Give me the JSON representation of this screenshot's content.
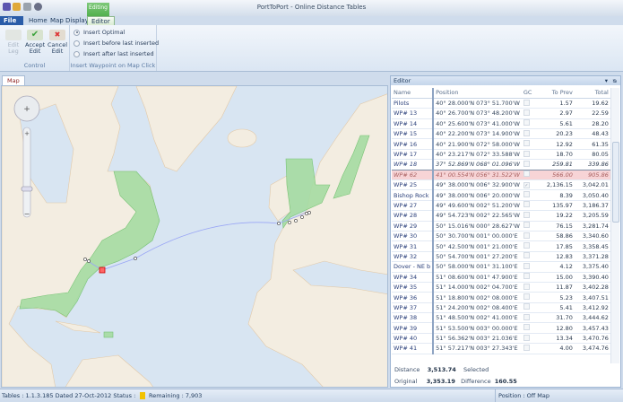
{
  "window": {
    "title": "PortToPort - Online Distance Tables",
    "context_tab": "Editing"
  },
  "menu_tabs": [
    "File",
    "Home",
    "Map Display",
    "Editor"
  ],
  "ribbon": {
    "control": {
      "label": "Control",
      "buttons": [
        "Edit Leg",
        "Accept Edit",
        "Cancel Edit"
      ]
    },
    "insert": {
      "label": "Insert Waypoint on Map Click",
      "options": [
        "Insert Optimal",
        "Insert before last inserted",
        "Insert after last inserted"
      ],
      "selected": 0
    }
  },
  "map": {
    "tab": "Map",
    "colors": {
      "water": "#d8e5f2",
      "land": "#f3ede1",
      "highlight": "#a6dca2",
      "route": "#9aa6f5"
    }
  },
  "editor": {
    "title": "Editor",
    "columns": [
      "Name",
      "Position",
      "GC",
      "To Prev",
      "Total"
    ],
    "rows": [
      {
        "name": "Pilots",
        "pos": "40° 28.000'N 073° 51.700'W",
        "gc": false,
        "prev": "1.57",
        "total": "19.62"
      },
      {
        "name": "WP# 13",
        "pos": "40° 26.700'N 073° 48.200'W",
        "gc": false,
        "prev": "2.97",
        "total": "22.59"
      },
      {
        "name": "WP# 14",
        "pos": "40° 25.600'N 073° 41.000'W",
        "gc": false,
        "prev": "5.61",
        "total": "28.20"
      },
      {
        "name": "WP# 15",
        "pos": "40° 22.200'N 073° 14.900'W",
        "gc": false,
        "prev": "20.23",
        "total": "48.43"
      },
      {
        "name": "WP# 16",
        "pos": "40° 21.900'N 072° 58.000'W",
        "gc": false,
        "prev": "12.92",
        "total": "61.35"
      },
      {
        "name": "WP# 17",
        "pos": "40° 23.217'N 072° 33.588'W",
        "gc": false,
        "prev": "18.70",
        "total": "80.05"
      },
      {
        "name": "WP# 18",
        "pos": "37° 52.869'N 068° 01.096'W",
        "gc": false,
        "prev": "259.81",
        "total": "339.86",
        "state": "sel"
      },
      {
        "name": "WP# 62",
        "pos": "41° 00.554'N 056° 31.522'W",
        "gc": false,
        "prev": "566.00",
        "total": "905.86",
        "state": "pink"
      },
      {
        "name": "WP# 25",
        "pos": "49° 38.000'N 006° 32.900'W",
        "gc": true,
        "prev": "2,136.15",
        "total": "3,042.01"
      },
      {
        "name": "Bishop Rock",
        "pos": "49° 38.000'N 006° 20.000'W",
        "gc": false,
        "prev": "8.39",
        "total": "3,050.40"
      },
      {
        "name": "WP# 27",
        "pos": "49° 49.600'N 002° 51.200'W",
        "gc": false,
        "prev": "135.97",
        "total": "3,186.37"
      },
      {
        "name": "WP# 28",
        "pos": "49° 54.723'N 002° 22.565'W",
        "gc": false,
        "prev": "19.22",
        "total": "3,205.59"
      },
      {
        "name": "WP# 29",
        "pos": "50° 15.016'N 000° 28.627'W",
        "gc": false,
        "prev": "76.15",
        "total": "3,281.74"
      },
      {
        "name": "WP# 30",
        "pos": "50° 30.700'N 001° 00.000'E",
        "gc": false,
        "prev": "58.86",
        "total": "3,340.60"
      },
      {
        "name": "WP# 31",
        "pos": "50° 42.500'N 001° 21.000'E",
        "gc": false,
        "prev": "17.85",
        "total": "3,358.45"
      },
      {
        "name": "WP# 32",
        "pos": "50° 54.700'N 001° 27.200'E",
        "gc": false,
        "prev": "12.83",
        "total": "3,371.28"
      },
      {
        "name": "Dover - NE b",
        "pos": "50° 58.000'N 001° 31.100'E",
        "gc": false,
        "prev": "4.12",
        "total": "3,375.40"
      },
      {
        "name": "WP# 34",
        "pos": "51° 08.600'N 001° 47.900'E",
        "gc": false,
        "prev": "15.00",
        "total": "3,390.40"
      },
      {
        "name": "WP# 35",
        "pos": "51° 14.000'N 002° 04.700'E",
        "gc": false,
        "prev": "11.87",
        "total": "3,402.28"
      },
      {
        "name": "WP# 36",
        "pos": "51° 18.800'N 002° 08.000'E",
        "gc": false,
        "prev": "5.23",
        "total": "3,407.51"
      },
      {
        "name": "WP# 37",
        "pos": "51° 24.200'N 002° 08.400'E",
        "gc": false,
        "prev": "5.41",
        "total": "3,412.92"
      },
      {
        "name": "WP# 38",
        "pos": "51° 48.500'N 002° 41.000'E",
        "gc": false,
        "prev": "31.70",
        "total": "3,444.62"
      },
      {
        "name": "WP# 39",
        "pos": "51° 53.500'N 003° 00.000'E",
        "gc": false,
        "prev": "12.80",
        "total": "3,457.43"
      },
      {
        "name": "WP# 40",
        "pos": "51° 56.362'N 003° 21.036'E",
        "gc": false,
        "prev": "13.34",
        "total": "3,470.76"
      },
      {
        "name": "WP# 41",
        "pos": "51° 57.217'N 003° 27.343'E",
        "gc": false,
        "prev": "4.00",
        "total": "3,474.76"
      }
    ],
    "summary": {
      "distance_label": "Distance",
      "distance": "3,513.74",
      "selected_label": "Selected",
      "original_label": "Original",
      "original": "3,353.19",
      "difference_label": "Difference",
      "difference": "160.55"
    }
  },
  "status": {
    "tables": "Tables : 1.1.3.185 Dated 27-Oct-2012 Status :",
    "remaining": "Remaining : 7,903",
    "position": "Position : Off Map"
  }
}
